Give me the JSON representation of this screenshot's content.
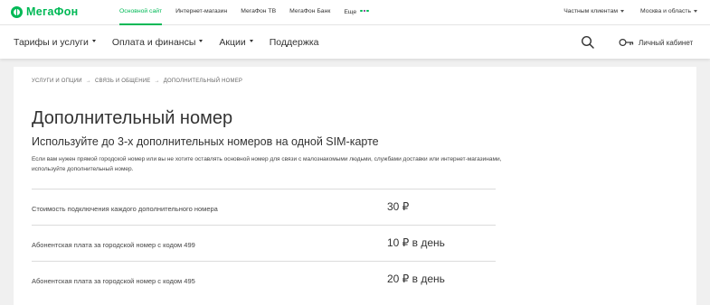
{
  "brand": {
    "name": "МегаФон",
    "color": "#00b956"
  },
  "top_links": [
    {
      "label": "Основной сайт",
      "active": true
    },
    {
      "label": "Интернет-магазин",
      "active": false
    },
    {
      "label": "МегаФон ТВ",
      "active": false
    },
    {
      "label": "МегаФон Банк",
      "active": false
    },
    {
      "label": "Еще",
      "active": false
    }
  ],
  "more_dots_colors": [
    "#00b956",
    "#731982",
    "#00b956"
  ],
  "top_right": {
    "customer_type": "Частным клиентам",
    "region": "Москва и область"
  },
  "main_nav": [
    {
      "label": "Тарифы и услуги",
      "dropdown": true
    },
    {
      "label": "Оплата и финансы",
      "dropdown": true
    },
    {
      "label": "Акции",
      "dropdown": true
    },
    {
      "label": "Поддержка",
      "dropdown": false
    }
  ],
  "icons": {
    "search": "search-icon",
    "account": "key-icon"
  },
  "account_label": "Личный кабинет",
  "breadcrumb": [
    "УСЛУГИ И ОПЦИИ",
    "СВЯЗЬ И ОБЩЕНИЕ",
    "ДОПОЛНИТЕЛЬНЫЙ НОМЕР"
  ],
  "breadcrumb_separator": "→",
  "page": {
    "title": "Дополнительный номер",
    "subtitle": "Используйте до 3-х дополнительных номеров на одной SIM-карте",
    "description": "Если вам нужен прямой городской номер или вы не хотите оставлять основной номер для связи с малознакомыми людьми, службами доставки или интернет-магазинами, используйте дополнительный номер."
  },
  "prices": [
    {
      "label": "Стоимость подключения каждого дополнительного номера",
      "value": "30 ₽"
    },
    {
      "label": "Абонентская плата за городской номер с кодом 499",
      "value": "10 ₽ в день"
    },
    {
      "label": "Абонентская плата за городской номер с кодом 495",
      "value": "20 ₽ в день"
    }
  ]
}
